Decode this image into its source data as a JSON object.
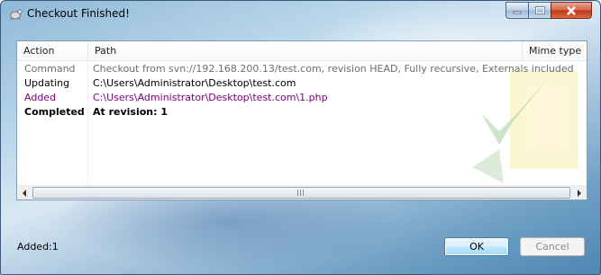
{
  "window": {
    "title": "Checkout Finished!"
  },
  "icons": {
    "app": "tortoise-svn-icon",
    "minimize": "minimize-icon",
    "maximize": "maximize-icon",
    "close": "close-icon"
  },
  "columns": {
    "action": "Action",
    "path": "Path",
    "mime": "Mime type"
  },
  "rows": [
    {
      "action": "Command",
      "path": "Checkout from svn://192.168.200.13/test.com, revision HEAD, Fully recursive, Externals included",
      "color": "#6d6d6d",
      "bold": false
    },
    {
      "action": "Updating",
      "path": "C:\\Users\\Administrator\\Desktop\\test.com",
      "color": "#000000",
      "bold": false
    },
    {
      "action": "Added",
      "path": "C:\\Users\\Administrator\\Desktop\\test.com\\1.php",
      "color": "#800080",
      "bold": false
    },
    {
      "action": "Completed",
      "path": "At revision: 1",
      "color": "#000000",
      "bold": true
    }
  ],
  "status": {
    "added": "Added:1"
  },
  "buttons": {
    "ok": "OK",
    "cancel": "Cancel"
  }
}
